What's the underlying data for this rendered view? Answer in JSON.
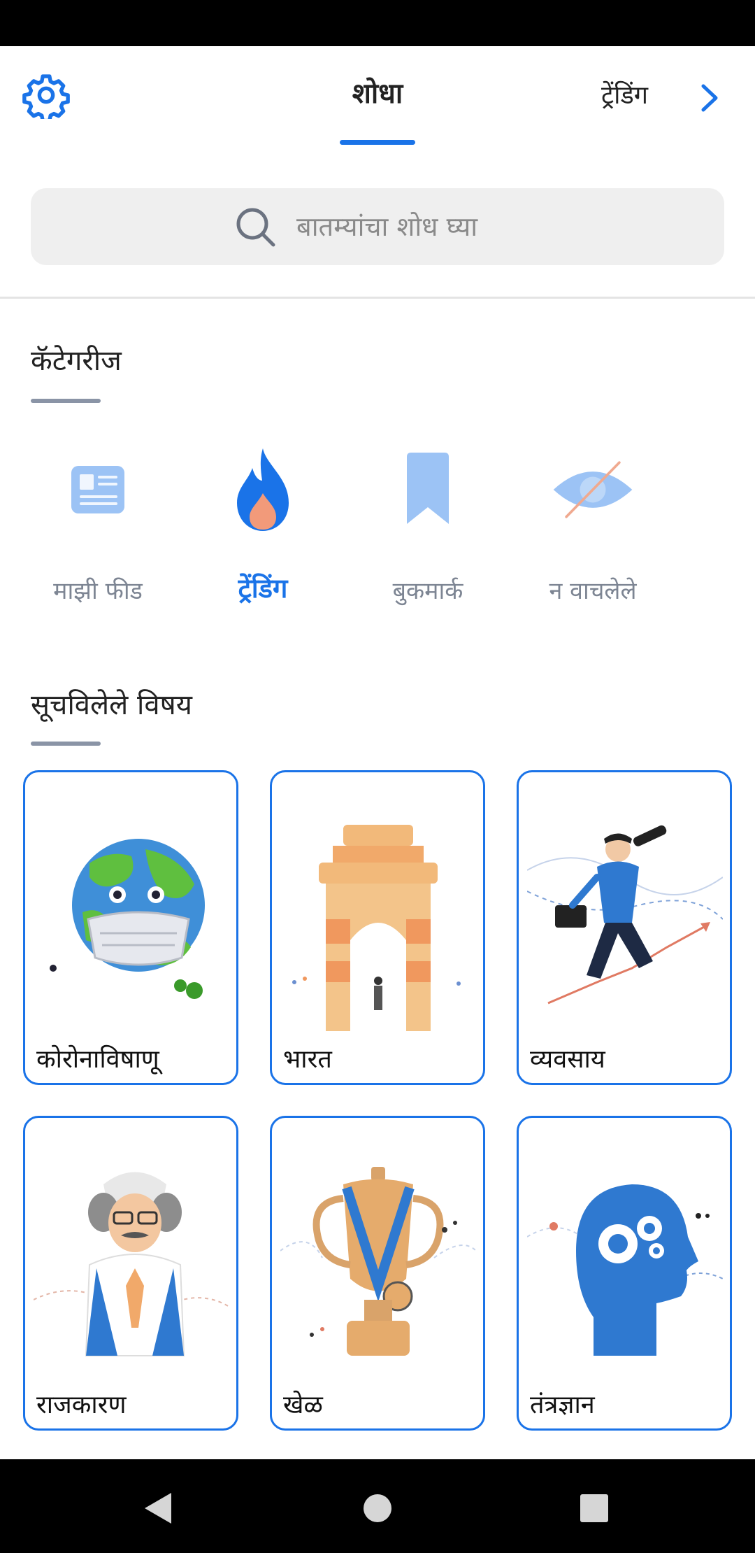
{
  "header": {
    "discover_tab": "शोधा",
    "trending_tab": "ट्रेंडिंग"
  },
  "search": {
    "placeholder": "बातम्यांचा शोध घ्या"
  },
  "categories": {
    "title": "कॅटेगरीज",
    "items": [
      {
        "label": "माझी फीड",
        "icon": "newspaper-icon",
        "active": false
      },
      {
        "label": "ट्रेंडिंग",
        "icon": "flame-icon",
        "active": true
      },
      {
        "label": "बुकमार्क",
        "icon": "bookmark-icon",
        "active": false
      },
      {
        "label": "न वाचलेले",
        "icon": "eye-off-icon",
        "active": false
      }
    ]
  },
  "topics": {
    "title": "सूचविलेले विषय",
    "items": [
      {
        "label": "कोरोनाविषाणू",
        "icon": "masked-globe-icon"
      },
      {
        "label": "भारत",
        "icon": "india-gate-icon"
      },
      {
        "label": "व्यवसाय",
        "icon": "businessman-telescope-icon"
      },
      {
        "label": "राजकारण",
        "icon": "politician-icon"
      },
      {
        "label": "खेळ",
        "icon": "trophy-icon"
      },
      {
        "label": "तंत्रज्ञान",
        "icon": "head-gears-icon"
      }
    ]
  },
  "colors": {
    "accent": "#1a73e8",
    "muted": "#7d8593",
    "search_bg": "#efefef",
    "card_border": "#1a73e8"
  }
}
